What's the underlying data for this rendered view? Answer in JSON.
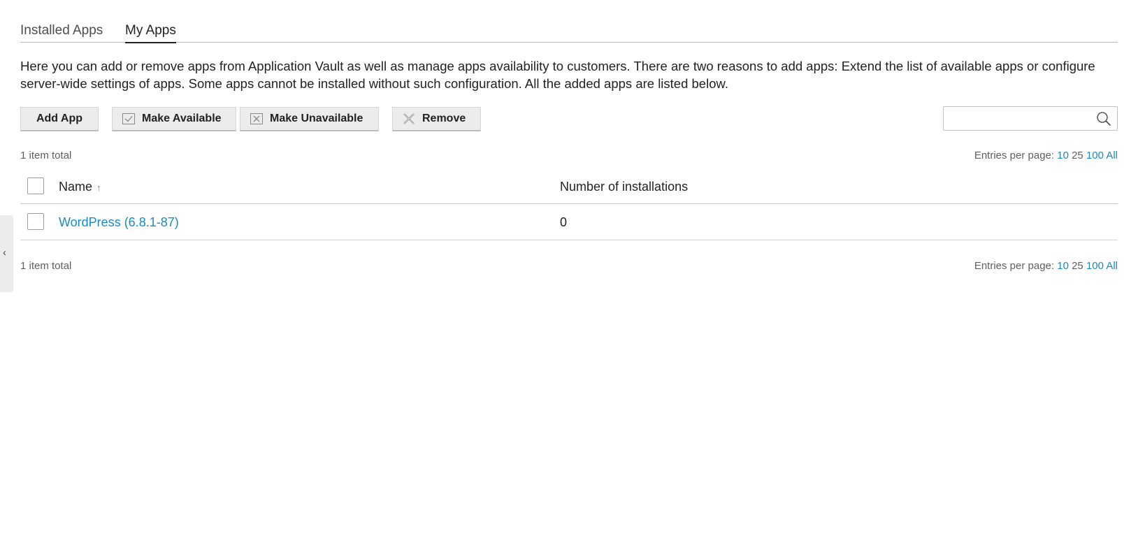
{
  "tabs": {
    "installed": "Installed Apps",
    "my_apps": "My Apps",
    "active": "my_apps"
  },
  "description": "Here you can add or remove apps from Application Vault as well as manage apps availability to customers. There are two reasons to add apps: Extend the list of available apps or configure server-wide settings of apps. Some apps cannot be installed without such configuration. All the added apps are listed below.",
  "toolbar": {
    "add_label": "Add App",
    "make_available_label": "Make Available",
    "make_unavailable_label": "Make Unavailable",
    "remove_label": "Remove"
  },
  "search": {
    "placeholder": "",
    "value": ""
  },
  "summary": {
    "total": "1 item total"
  },
  "pagination": {
    "label": "Entries per page:",
    "options": [
      "10",
      "25",
      "100",
      "All"
    ],
    "current": "25"
  },
  "table": {
    "columns": {
      "name": "Name",
      "installations": "Number of installations"
    },
    "sort_indicator": "↑",
    "rows": [
      {
        "name": "WordPress (6.8.1-87)",
        "installations": "0"
      }
    ]
  },
  "sidebar_toggle": "‹",
  "colors": {
    "link": "#1a8ac4",
    "button_bg": "#ececec"
  }
}
